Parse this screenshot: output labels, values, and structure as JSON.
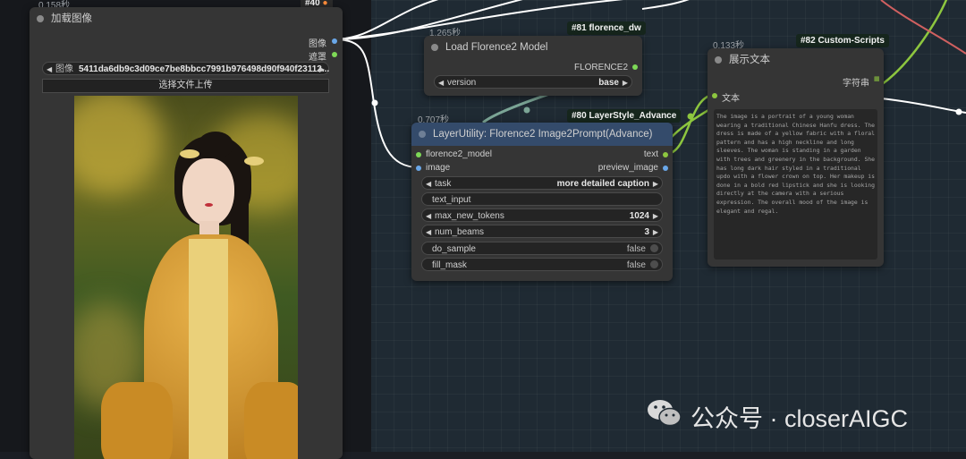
{
  "load_image_node": {
    "timer": "0.158秒",
    "id_badge": "#40",
    "title": "加载图像",
    "output_image": "图像",
    "output_mask": "遮罩",
    "image_widget_label": "图像",
    "image_filename": "5411da6db9c3d09ce7be8bbcc7991b976498d90f940f23112...",
    "upload_button": "选择文件上传"
  },
  "florence_loader_node": {
    "timer": "1.265秒",
    "id_badge": "#81 florence_dw",
    "title": "Load Florence2 Model",
    "output": "FLORENCE2",
    "version_label": "version",
    "version_value": "base"
  },
  "image2prompt_node": {
    "timer": "0.707秒",
    "id_badge": "#80 LayerStyle_Advance",
    "title": "LayerUtility: Florence2 Image2Prompt(Advance)",
    "input_model": "florence2_model",
    "input_image": "image",
    "output_text": "text",
    "output_preview": "preview_image",
    "widgets": [
      {
        "label": "task",
        "value": "more detailed caption"
      },
      {
        "label": "text_input",
        "value": ""
      },
      {
        "label": "max_new_tokens",
        "value": "1024"
      },
      {
        "label": "num_beams",
        "value": "3"
      },
      {
        "label": "do_sample",
        "value": "false"
      },
      {
        "label": "fill_mask",
        "value": "false"
      }
    ]
  },
  "show_text_node": {
    "timer": "0.133秒",
    "id_badge": "#82 Custom-Scripts",
    "title": "展示文本",
    "output": "字符串",
    "input": "文本",
    "content": "The image is a portrait of a young woman wearing a traditional Chinese Hanfu dress. The dress is made of a yellow fabric with a floral pattern and has a high neckline and long sleeves. The woman is standing in a garden with trees and greenery in the background. She has long dark hair styled in a traditional updo with a flower crown on top. Her makeup is done in a bold red lipstick and she is looking directly at the camera with a serious expression. The overall mood of the image is elegant and regal."
  },
  "watermark": {
    "text": "公众号 · closerAIGC",
    "icon": "wechat-icon"
  },
  "colors": {
    "canvas": "#1f2a33",
    "node_body": "#353535",
    "green_port": "#7ed957",
    "blue_port": "#6aa7e8",
    "model_link": "#7ba596",
    "text_link": "#8dc63f"
  }
}
